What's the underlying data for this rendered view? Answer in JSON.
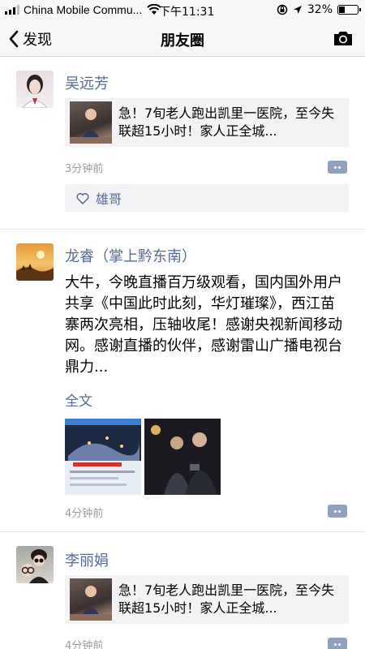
{
  "status_bar": {
    "carrier": "China Mobile Commu...",
    "time": "下午11:31",
    "battery_text": "32%",
    "battery_level": 0.32
  },
  "nav": {
    "back_label": "发现",
    "title": "朋友圈",
    "camera_icon": "camera-icon"
  },
  "posts": [
    {
      "author": "吴远芳",
      "share_title": "急！7旬老人跑出凯里一医院，至今失联超15小时！家人正全城...",
      "time": "3分钟前",
      "likes": "雄哥"
    },
    {
      "author": "龙睿（掌上黔东南）",
      "text": "大牛，今晚直播百万级观看，国内国外用户共享《中国此时此刻，华灯璀璨》，西江苗寨两次亮相，压轴收尾！感谢央视新闻移动网。感谢直播的伙伴，感谢雷山广播电视台鼎力...",
      "full_text_label": "全文",
      "time": "4分钟前"
    },
    {
      "author": "李丽娟",
      "share_title": "急！7旬老人跑出凯里一医院，至今失联超15小时！家人正全城...",
      "time": "4分钟前"
    }
  ],
  "colors": {
    "link_blue": "#576b95",
    "card_bg": "#f3f3f5",
    "bar_bg": "#f7f7f7",
    "meta_gray": "#9a9a9a"
  }
}
